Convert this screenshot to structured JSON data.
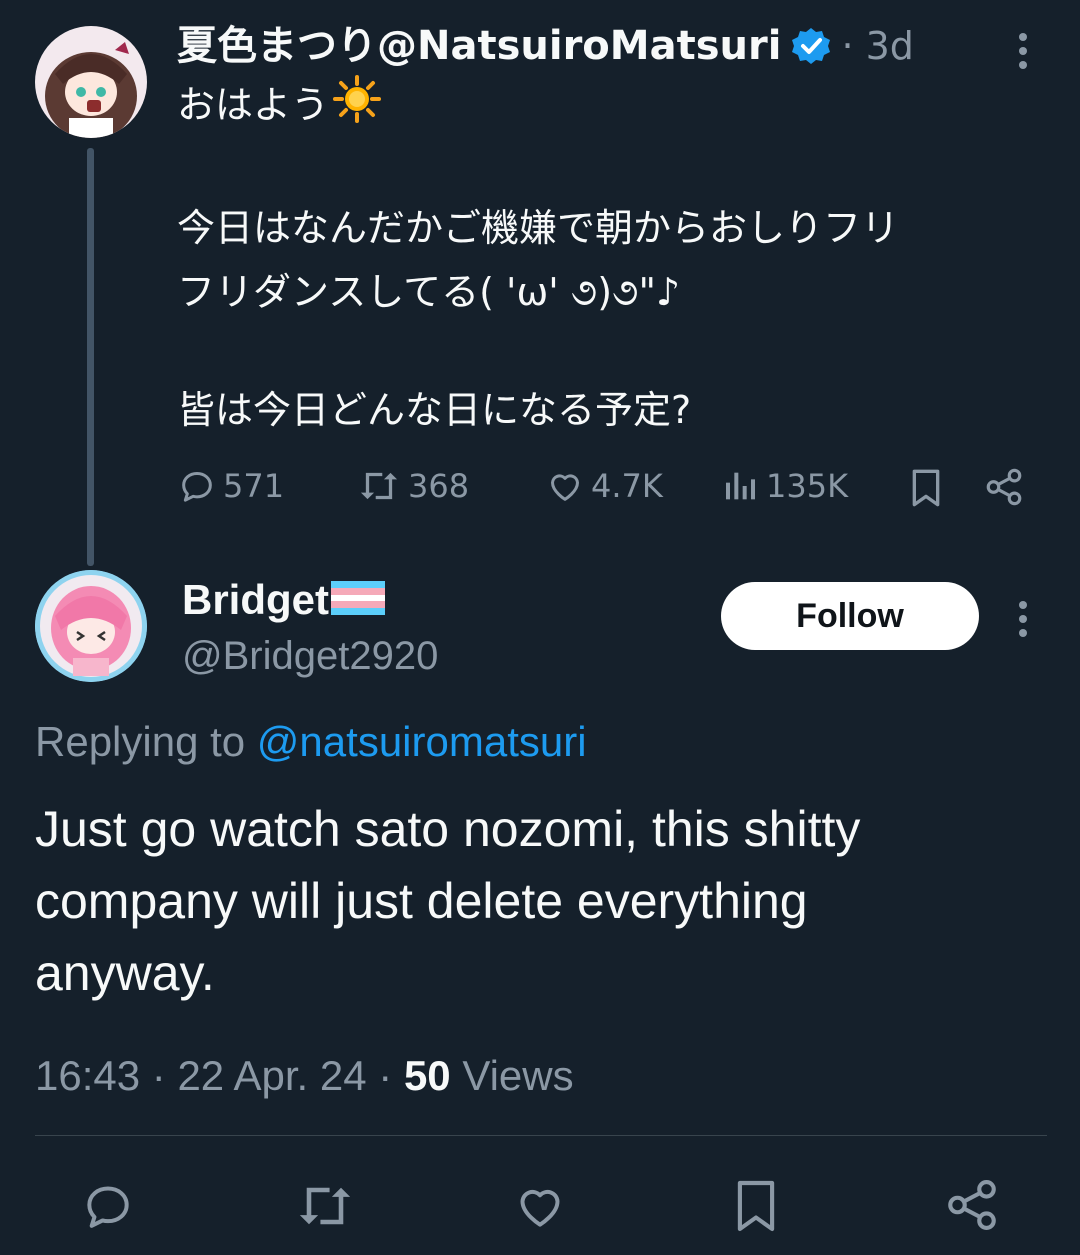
{
  "original_tweet": {
    "display_name": "夏色まつり@NatsuiroMatsuri",
    "time_ago": "· 3d",
    "lines": [
      "おはよう",
      "今日はなんだかご機嫌で朝からおしりフリ",
      "フリダンスしてる( 'ω' ૭)૭\"♪",
      "皆は今日どんな日になる予定?"
    ],
    "stats": {
      "replies": "571",
      "reposts": "368",
      "likes": "4.7K",
      "views": "135K"
    }
  },
  "reply": {
    "display_name": "Bridget",
    "handle": "@Bridget2920",
    "follow_label": "Follow",
    "replying_prefix": "Replying to",
    "replying_handle": "@natsuiromatsuri",
    "body_lines": [
      "Just go watch sato nozomi, this shitty",
      "company will just delete everything",
      "anyway."
    ],
    "time": "16:43",
    "date": "22 Apr. 24",
    "views_count": "50",
    "views_label": "Views"
  },
  "colors": {
    "background": "#15202b",
    "text": "#f7f9f9",
    "muted": "#8b98a5",
    "link": "#1d9bf0",
    "verified": "#1d9bf0"
  },
  "icons": [
    "verified-badge-icon",
    "sun-emoji-icon",
    "more-icon",
    "reply-icon",
    "repost-icon",
    "like-icon",
    "views-icon",
    "bookmark-icon",
    "share-icon",
    "trans-flag-icon"
  ]
}
